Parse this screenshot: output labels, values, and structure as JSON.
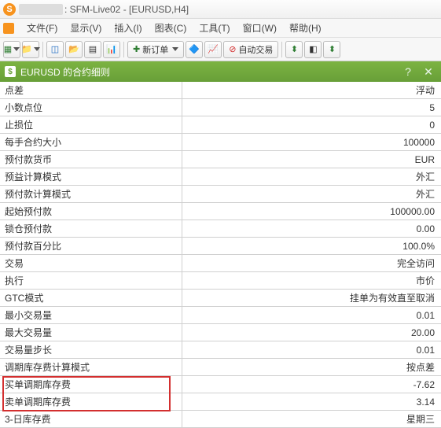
{
  "window": {
    "title": ": SFM-Live02 - [EURUSD,H4]"
  },
  "menu": {
    "file": "文件(F)",
    "view": "显示(V)",
    "insert": "插入(I)",
    "chart": "图表(C)",
    "tool": "工具(T)",
    "window": "窗口(W)",
    "help": "帮助(H)"
  },
  "toolbar": {
    "newOrder": "新订单",
    "autoTrade": "自动交易"
  },
  "panel": {
    "title": "EURUSD 的合约细则"
  },
  "rows": [
    {
      "k": "点差",
      "v": "浮动"
    },
    {
      "k": "小数点位",
      "v": "5"
    },
    {
      "k": "止损位",
      "v": "0"
    },
    {
      "k": "每手合约大小",
      "v": "100000"
    },
    {
      "k": "预付款货币",
      "v": "EUR"
    },
    {
      "k": "预益计算模式",
      "v": "外汇"
    },
    {
      "k": "预付款计算模式",
      "v": "外汇"
    },
    {
      "k": "起始预付款",
      "v": "100000.00"
    },
    {
      "k": "锁仓预付款",
      "v": "0.00"
    },
    {
      "k": "预付款百分比",
      "v": "100.0%"
    },
    {
      "k": "交易",
      "v": "完全访问"
    },
    {
      "k": "执行",
      "v": "市价"
    },
    {
      "k": "GTC模式",
      "v": "挂单为有效直至取消"
    },
    {
      "k": "最小交易量",
      "v": "0.01"
    },
    {
      "k": "最大交易量",
      "v": "20.00"
    },
    {
      "k": "交易量步长",
      "v": "0.01"
    },
    {
      "k": "调期库存费计算模式",
      "v": "按点差"
    },
    {
      "k": "买单调期库存费",
      "v": "-7.62"
    },
    {
      "k": "卖单调期库存费",
      "v": "3.14"
    },
    {
      "k": "3-日库存费",
      "v": "星期三"
    }
  ]
}
